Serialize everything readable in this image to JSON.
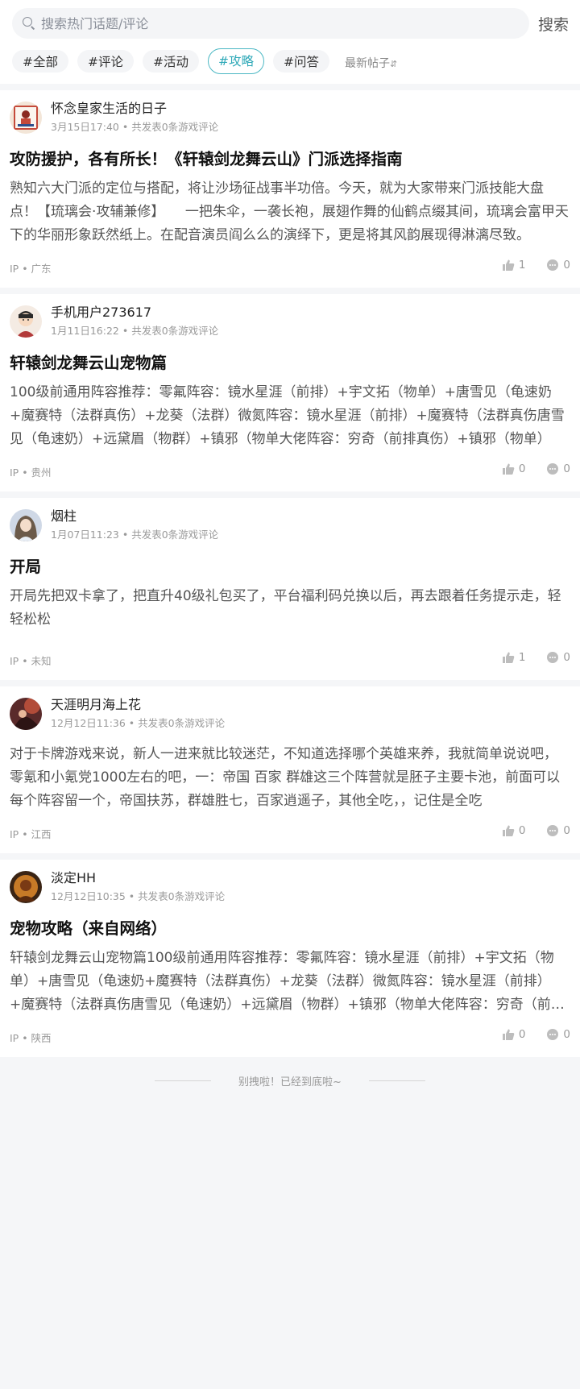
{
  "search": {
    "placeholder": "搜索热门话题/评论",
    "button": "搜索"
  },
  "tags": [
    {
      "label": "#全部"
    },
    {
      "label": "#评论"
    },
    {
      "label": "#活动"
    },
    {
      "label": "#攻略",
      "active": true
    },
    {
      "label": "#问答"
    }
  ],
  "sort": {
    "label": "最新帖子",
    "arrow": "⇵"
  },
  "posts": [
    {
      "user": "怀念皇家生活的日子",
      "meta": "3月15日17:40 • 共发表0条游戏评论",
      "title": "攻防援护，各有所长！《轩辕剑龙舞云山》门派选择指南",
      "content": "熟知六大门派的定位与搭配，将让沙场征战事半功倍。今天，就为大家带来门派技能大盘点！【琉璃会·攻辅兼修】　　一把朱伞，一袭长袍，展翅作舞的仙鹤点缀其间，琉璃会富甲天下的华丽形象跃然纸上。在配音演员阎么么的演绎下，更是将其风韵展现得淋漓尽致。",
      "ip": "IP • 广东",
      "likes": "1",
      "comments": "0"
    },
    {
      "user": "手机用户273617",
      "meta": "1月11日16:22 • 共发表0条游戏评论",
      "title": "轩辕剑龙舞云山宠物篇",
      "content": "100级前通用阵容推荐：零氟阵容：镜水星涯（前排）+宇文拓（物单）+唐雪见（龟速奶+魔赛特（法群真伤）+龙葵（法群）微氮阵容：镜水星涯（前排）+魔赛特（法群真伤唐雪见（龟速奶）+远黛眉（物群）+镇邪（物单大佬阵容：穷奇（前排真伤）+镇邪（物单）",
      "ip": "IP • 贵州",
      "likes": "0",
      "comments": "0"
    },
    {
      "user": "烟柱",
      "meta": "1月07日11:23 • 共发表0条游戏评论",
      "title": "开局",
      "content": "开局先把双卡拿了，把直升40级礼包买了，平台福利码兑换以后，再去跟着任务提示走，轻轻松松",
      "ip": "IP • 未知",
      "likes": "1",
      "comments": "0"
    },
    {
      "user": "天涯明月海上花",
      "meta": "12月12日11:36 • 共发表0条游戏评论",
      "title": "",
      "content": "对于卡牌游戏来说，新人一进来就比较迷茫，不知道选择哪个英雄来养，我就简单说说吧，零氪和小氪党1000左右的吧，一：帝国 百家 群雄这三个阵营就是胚子主要卡池，前面可以每个阵容留一个，帝国扶苏，群雄胜七，百家逍遥子，其他全吃，，记住是全吃",
      "ip": "IP • 江西",
      "likes": "0",
      "comments": "0"
    },
    {
      "user": "淡定HH",
      "meta": "12月12日10:35 • 共发表0条游戏评论",
      "title": "宠物攻略（来自网络）",
      "content": "轩辕剑龙舞云山宠物篇100级前通用阵容推荐：零氟阵容：镜水星涯（前排）+宇文拓（物单）+唐雪见（龟速奶+魔赛特（法群真伤）+龙葵（法群）微氮阵容：镜水星涯（前排）+魔赛特（法群真伤唐雪见（龟速奶）+远黛眉（物群）+镇邪（物单大佬阵容：穷奇（前排真伤）",
      "ip": "IP • 陕西",
      "likes": "0",
      "comments": "0"
    }
  ],
  "end_text": "别拽啦！已经到底啦~"
}
